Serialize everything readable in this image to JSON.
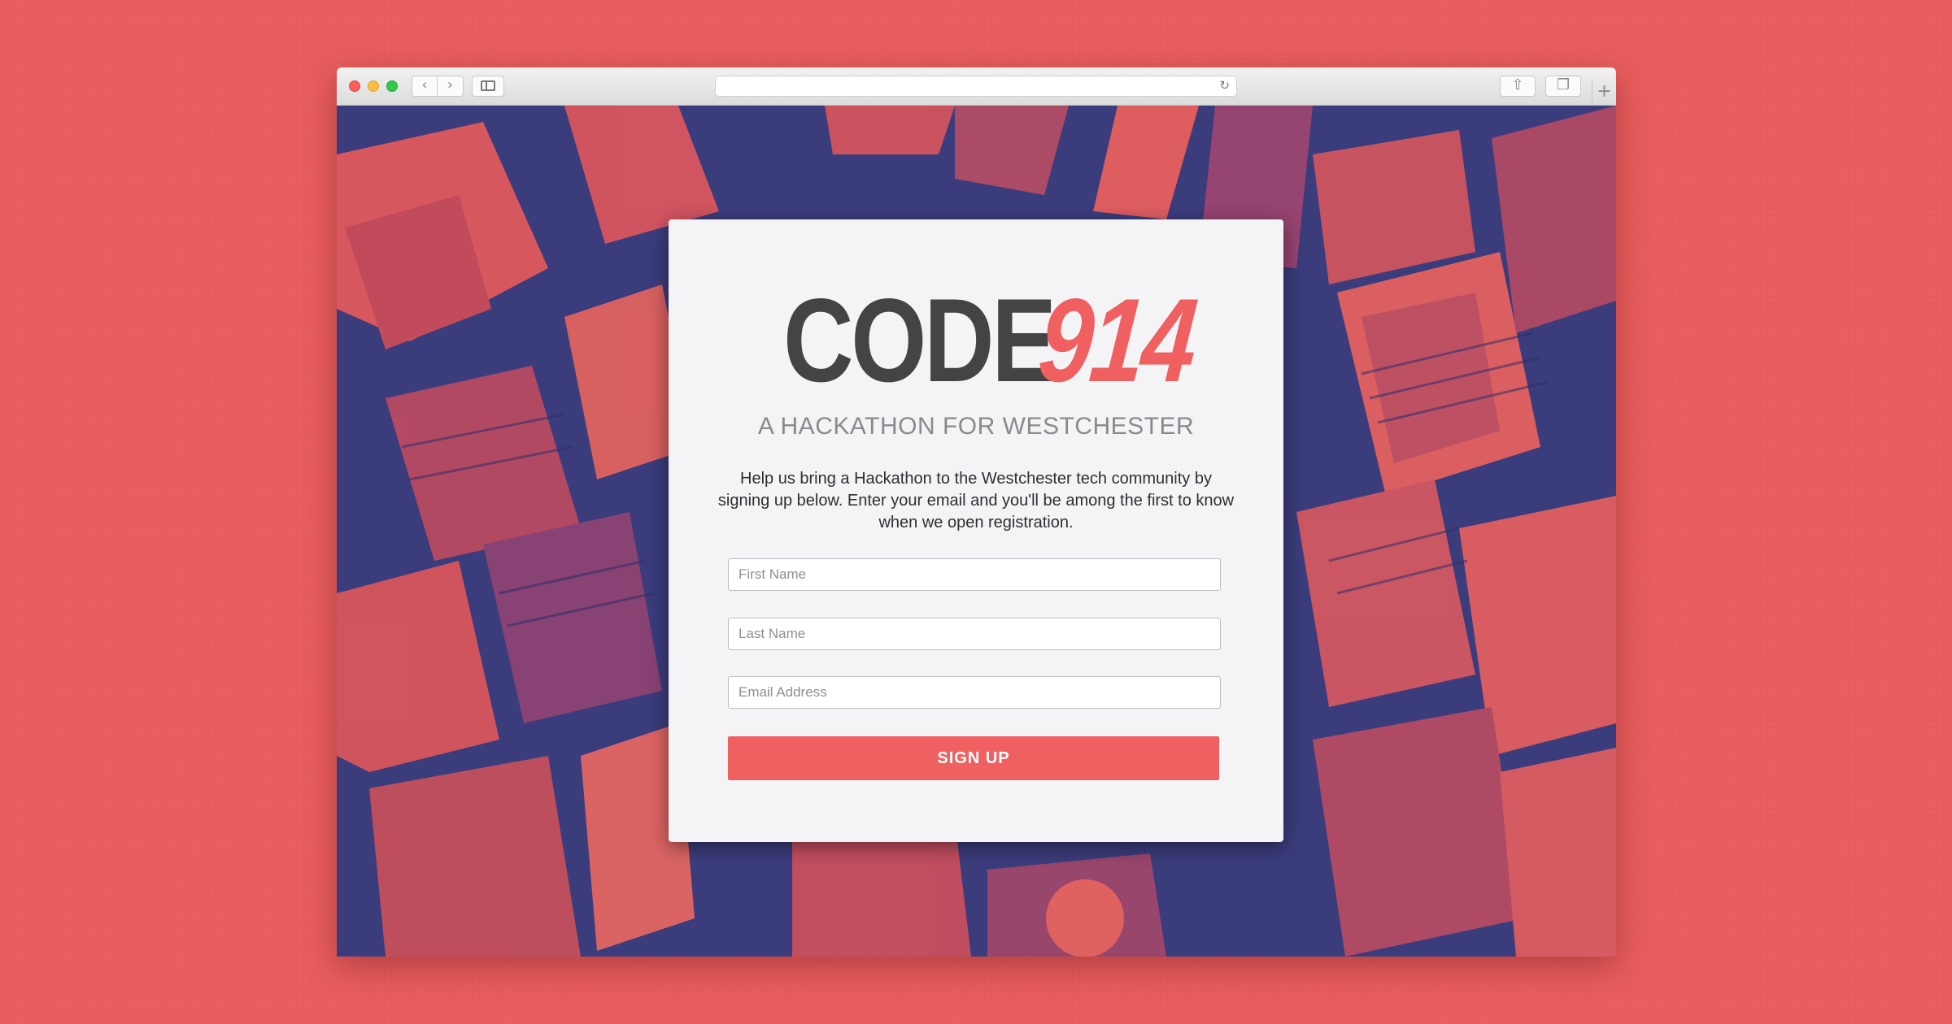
{
  "browser": {
    "back_glyph": "‹",
    "forward_glyph": "›",
    "reload_glyph": "↻",
    "share_glyph": "⇧",
    "tabs_glyph": "❐",
    "newtab_glyph": "+",
    "url": ""
  },
  "page": {
    "logo_word": "CODE",
    "logo_number": "914",
    "tagline": "A HACKATHON FOR WESTCHESTER",
    "description": "Help us bring a Hackathon to the Westchester tech community by signing up below. Enter your email and you'll be among the first to know when we open registration.",
    "form": {
      "first_name_placeholder": "First Name",
      "last_name_placeholder": "Last Name",
      "email_placeholder": "Email Address",
      "submit_label": "SIGN UP"
    }
  },
  "colors": {
    "accent": "#f06061",
    "logo_dark": "#444447",
    "background": "#e85d5d",
    "duotone_dark": "#3b3c7c"
  }
}
